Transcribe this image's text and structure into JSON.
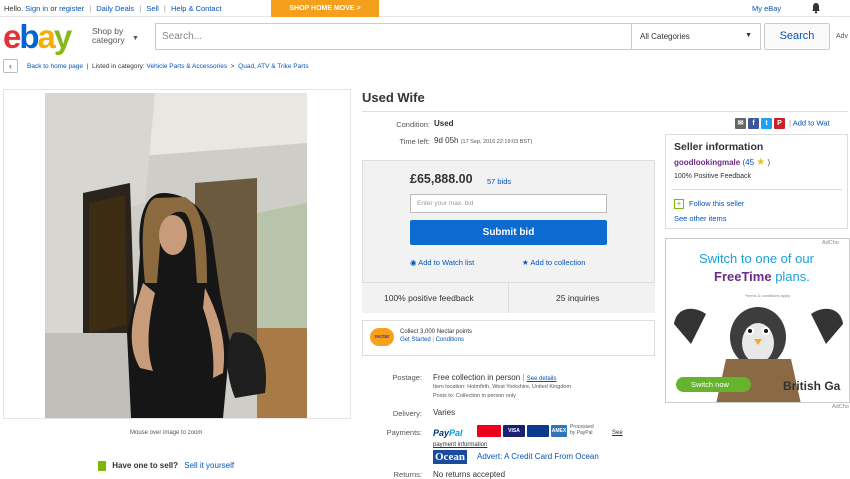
{
  "topbar": {
    "hello": "Hello.",
    "signin": "Sign in",
    "or": "or",
    "register": "register",
    "daily": "Daily Deals",
    "sell": "Sell",
    "help": "Help & Contact",
    "promo": "SHOP HOME MOVE >",
    "myebay": "My eBay"
  },
  "header": {
    "logo_letters": [
      "e",
      "b",
      "a",
      "y"
    ],
    "logo_colors": [
      "#e53238",
      "#0064d2",
      "#f5af02",
      "#86b817"
    ],
    "shop_by_1": "Shop by",
    "shop_by_2": "category",
    "search_placeholder": "Search...",
    "categories": "All Categories",
    "search_button": "Search",
    "advanced": "Adv"
  },
  "breadcrumb": {
    "back": "Back to home page",
    "listed_in": "Listed in category:",
    "cat1": "Vehicle Parts & Accessories",
    "cat2": "Quad, ATV & Trike Parts"
  },
  "gallery": {
    "zoom_hint": "Mouse over image to zoom",
    "have_one": "Have one to sell?",
    "sell_it": "Sell it yourself"
  },
  "item": {
    "title": "Used Wife",
    "condition_label": "Condition:",
    "condition": "Used",
    "time_left_label": "Time left:",
    "time_left": "9d 05h",
    "end_date": "(17 Sep, 2016   22:19:03 BST)",
    "add_to_watch": "Add to Wat",
    "price": "£65,888.00",
    "bids": "57 bids",
    "max_bid_placeholder": "Enter your max. bid",
    "submit_bid": "Submit bid",
    "add_watch_list": "Add to Watch list",
    "add_collection": "Add to collection",
    "positive_feedback": "100% positive feedback",
    "inquiries": "25 inquiries",
    "nectar_1": "Collect 3,000 Nectar points",
    "nectar_2a": "Get Started",
    "nectar_2b": "Conditions",
    "nectar_badge": "nectar"
  },
  "shipping": {
    "postage_label": "Postage:",
    "postage": "Free collection in person",
    "see_details": "See details",
    "item_location": "Item location:  Holmfirth, West Yorkshire, United Kingdom",
    "posts_to": "Posts to:  Collection in person only",
    "delivery_label": "Delivery:",
    "delivery": "Varies",
    "payments_label": "Payments:",
    "paypal_a": "Pay",
    "paypal_b": "Pal",
    "cards": [
      "",
      "VISA",
      "",
      "AMEX"
    ],
    "processed_1": "Processed",
    "processed_2": "by PayPal",
    "see": "See",
    "payment_info": "payment information",
    "ocean_logo": "Ocean",
    "ocean_ad": "Advert: A Credit Card From Ocean",
    "returns_label": "Returns:",
    "returns": "No returns accepted"
  },
  "seller": {
    "heading": "Seller information",
    "name": "goodlookingmale",
    "score": "(45",
    "close": ")",
    "positive": "100% Positive Feedback",
    "follow": "Follow this seller",
    "see_other": "See other items"
  },
  "ad": {
    "choices": "AdCho",
    "line1": "Switch to one of our",
    "line2_bold": "FreeTime",
    "line2_rest": " plans.",
    "small": "*terms & conditions apply",
    "button": "Switch now",
    "brand": "British Ga",
    "choices2": "AdCho"
  }
}
